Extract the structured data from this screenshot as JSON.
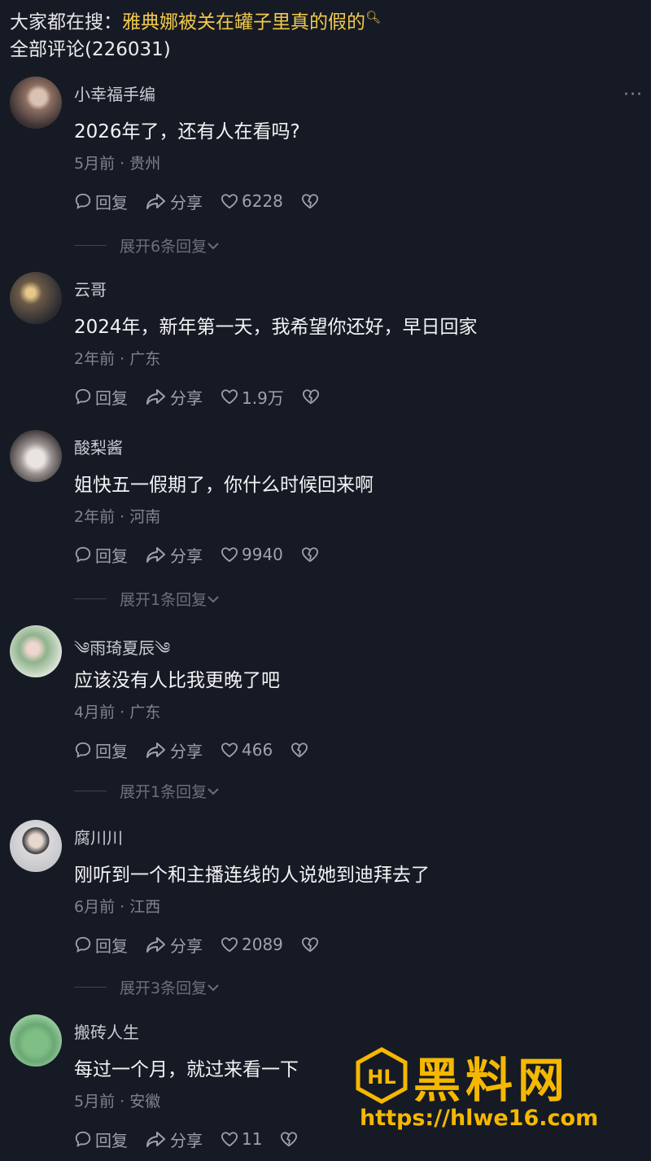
{
  "header": {
    "search_prefix": "大家都在搜：",
    "search_query": "雅典娜被关在罐子里真的假的",
    "comment_count": "全部评论(226031)"
  },
  "actions": {
    "reply": "回复",
    "share": "分享"
  },
  "comments": [
    {
      "user": "小幸福手编",
      "text": "2026年了，还有人在看吗?",
      "meta": "5月前 · 贵州",
      "likes": "6228",
      "expand": "展开6条回复"
    },
    {
      "user": "云哥",
      "text": "2024年，新年第一天，我希望你还好，早日回家",
      "meta": "2年前 · 广东",
      "likes": "1.9万",
      "expand": ""
    },
    {
      "user": "酸梨酱",
      "text": "姐快五一假期了，你什么时候回来啊",
      "meta": "2年前 · 河南",
      "likes": "9940",
      "expand": "展开1条回复"
    },
    {
      "user": "༄雨琦夏辰༄",
      "text": "应该没有人比我更晚了吧",
      "meta": "4月前 · 广东",
      "likes": "466",
      "expand": "展开1条回复"
    },
    {
      "user": "腐川川",
      "text": "刚听到一个和主播连线的人说她到迪拜去了",
      "meta": "6月前 · 江西",
      "likes": "2089",
      "expand": "展开3条回复"
    },
    {
      "user": "搬砖人生",
      "text": "每过一个月，就过来看一下",
      "meta": "5月前 · 安徽",
      "likes": "11",
      "expand": ""
    }
  ],
  "watermark": {
    "title": "黑料网",
    "url": "https://hlwe16.com",
    "logo_text": "HL"
  },
  "colors": {
    "background": "#161a24",
    "highlight": "#f2c94c",
    "watermark": "#f5b800"
  }
}
